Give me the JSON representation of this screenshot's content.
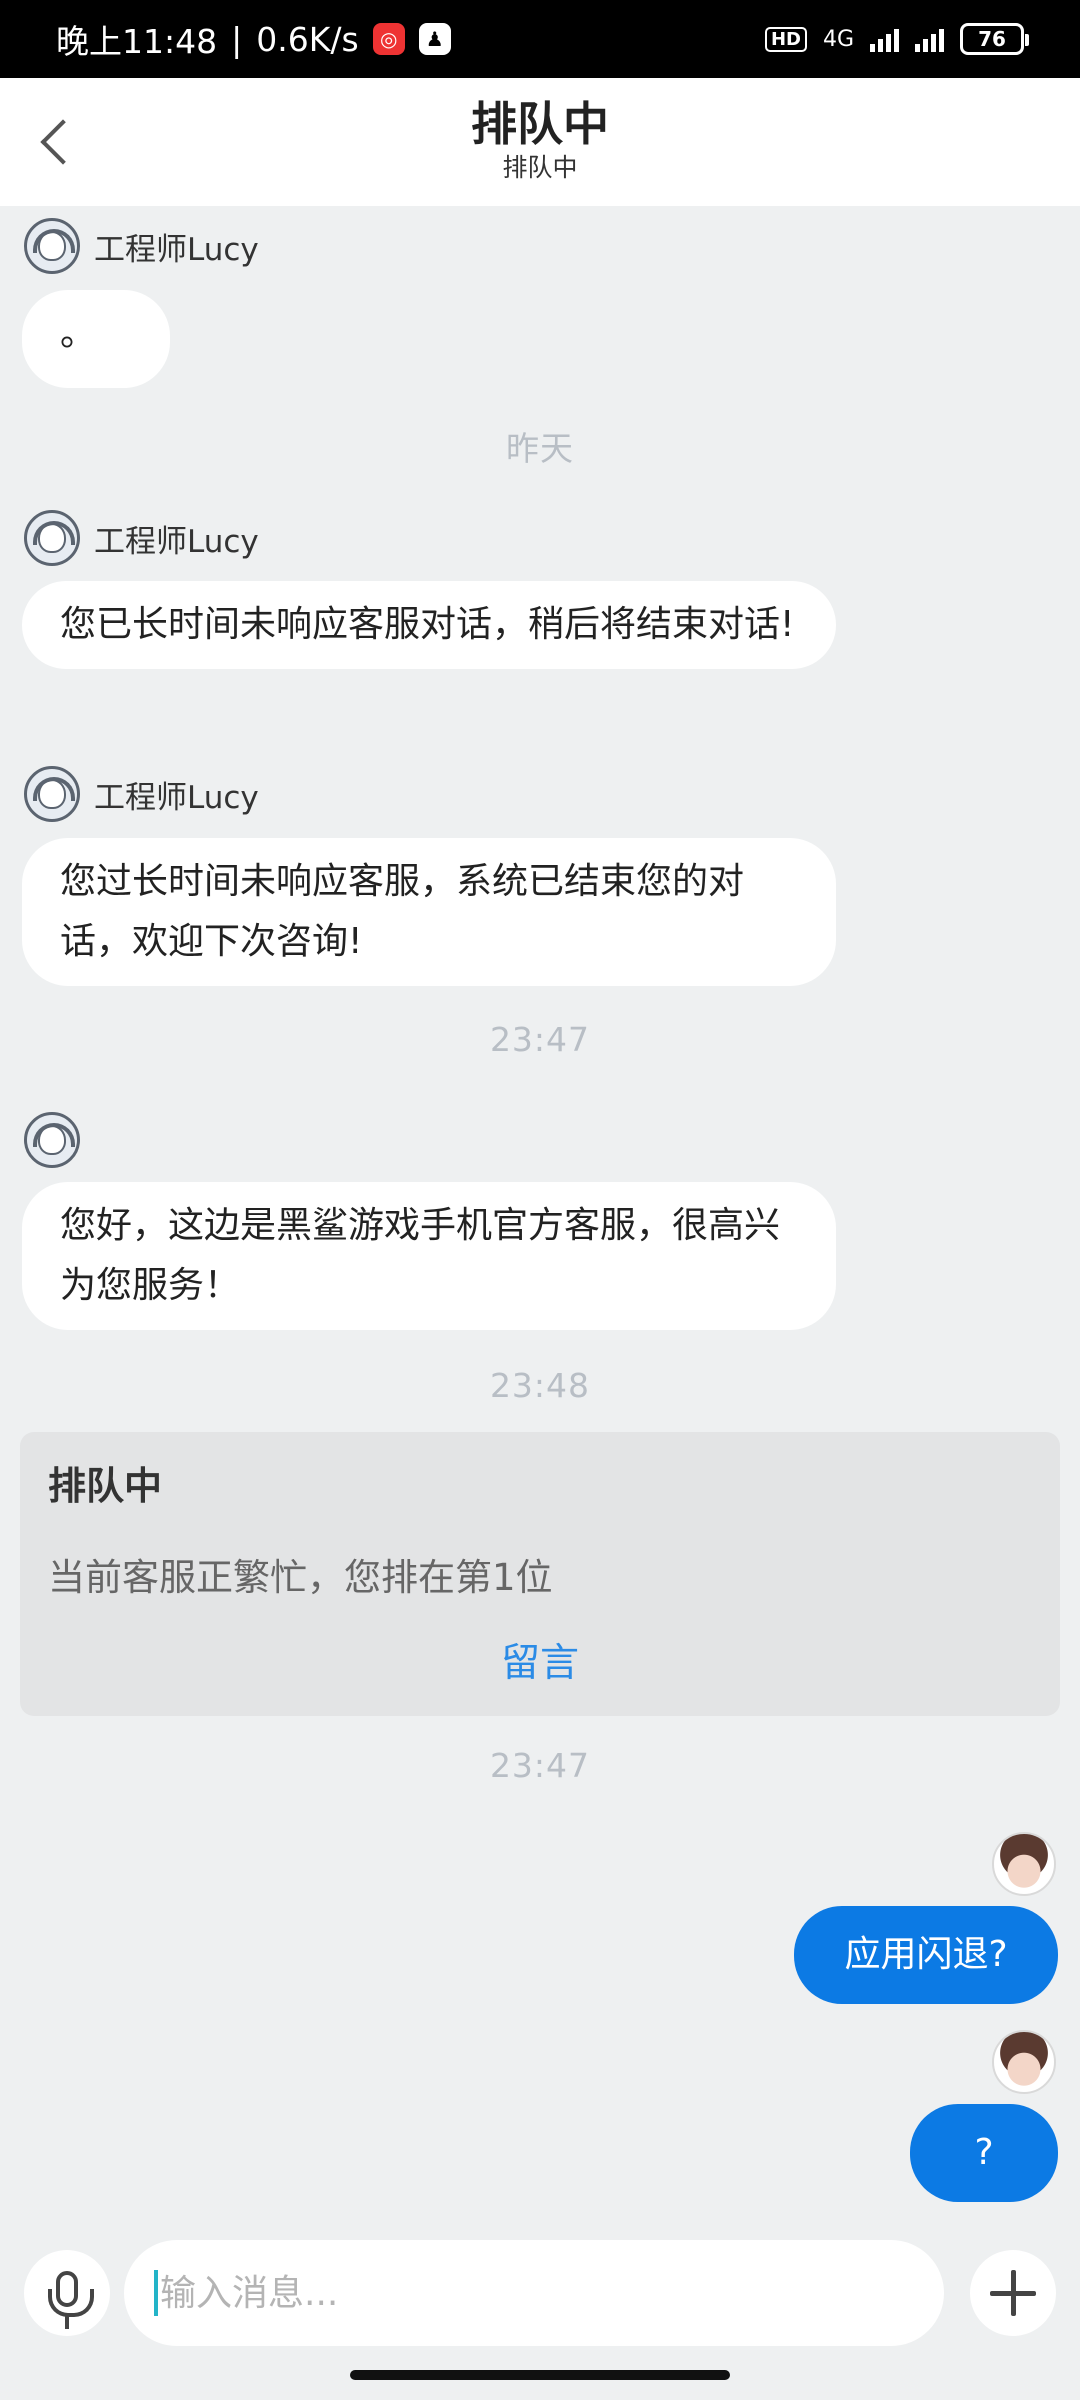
{
  "status_bar": {
    "time": "晚上11:48",
    "speed": "0.6K/s",
    "hd": "HD",
    "network": "4G",
    "battery": "76",
    "separator": "|"
  },
  "header": {
    "title": "排队中",
    "subtitle": "排队中"
  },
  "messages": {
    "m1_sender": "工程师Lucy",
    "m1_text": "。",
    "date_label": "昨天",
    "m2_sender": "工程师Lucy",
    "m2_text": "您已长时间未响应客服对话，稍后将结束对话!",
    "m3_sender": "工程师Lucy",
    "m3_text": "您过长时间未响应客服，系统已结束您的对话，欢迎下次咨询!",
    "time_1": "23:47",
    "m4_text": "您好，这边是黑鲨游戏手机官方客服，很高兴为您服务！",
    "time_2": "23:48",
    "time_3": "23:47",
    "u1_text": "应用闪退?",
    "u2_text": "?"
  },
  "queue": {
    "title": "排队中",
    "text": "当前客服正繁忙，您排在第1位",
    "link": "留言"
  },
  "input": {
    "placeholder": "输入消息..."
  }
}
